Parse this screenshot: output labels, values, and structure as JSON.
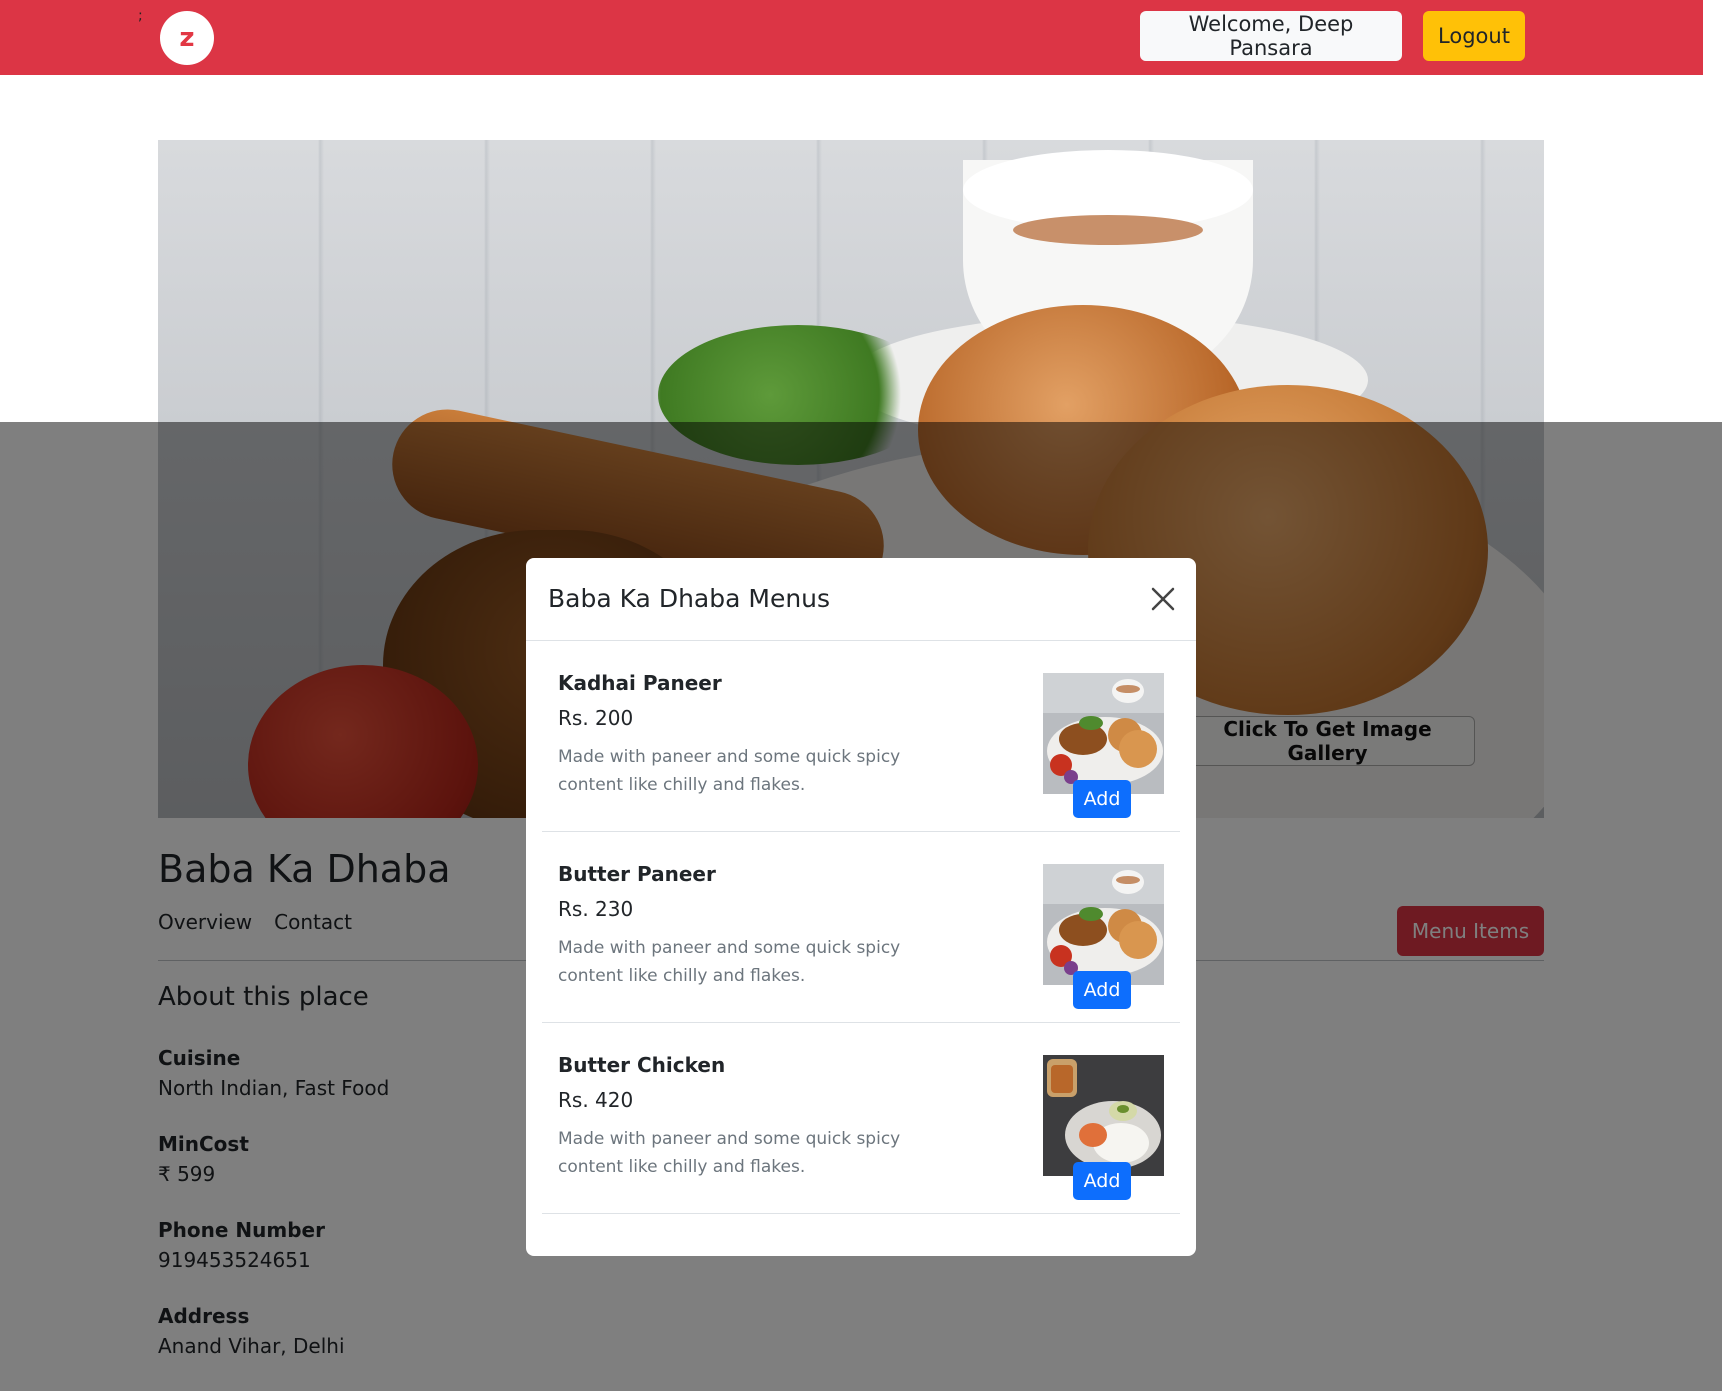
{
  "header": {
    "stray_mark": ";",
    "logo_letter": "z",
    "welcome_text": "Welcome, Deep Pansara",
    "logout_label": "Logout"
  },
  "hero": {
    "gallery_button_label": "Click To Get Image Gallery"
  },
  "restaurant": {
    "name": "Baba Ka Dhaba",
    "tabs": [
      {
        "label": "Overview"
      },
      {
        "label": "Contact"
      }
    ],
    "menu_items_button_label": "Menu Items",
    "about_title": "About this place",
    "info": [
      {
        "label": "Cuisine",
        "value": "North Indian, Fast Food"
      },
      {
        "label": "MinCost",
        "value": "₹ 599"
      },
      {
        "label": "Phone Number",
        "value": "919453524651"
      },
      {
        "label": "Address",
        "value": "Anand Vihar, Delhi"
      }
    ]
  },
  "modal": {
    "title": "Baba Ka Dhaba Menus",
    "items": [
      {
        "name": "Kadhai Paneer",
        "price": "Rs. 200",
        "description": "Made with paneer and some quick spicy content like chilly and flakes.",
        "image": "samosa-plate-thumbnail",
        "add_label": "Add"
      },
      {
        "name": "Butter Paneer",
        "price": "Rs. 230",
        "description": "Made with paneer and some quick spicy content like chilly and flakes.",
        "image": "samosa-plate-thumbnail",
        "add_label": "Add"
      },
      {
        "name": "Butter Chicken",
        "price": "Rs. 420",
        "description": "Made with paneer and some quick spicy content like chilly and flakes.",
        "image": "idli-plate-thumbnail",
        "add_label": "Add"
      }
    ]
  },
  "colors": {
    "header_bg": "#dc3545",
    "logout_bg": "#ffc107",
    "menu_items_bg": "#dc3545",
    "add_button_bg": "#0d6efd",
    "backdrop": "rgba(0,0,0,0.5)"
  }
}
